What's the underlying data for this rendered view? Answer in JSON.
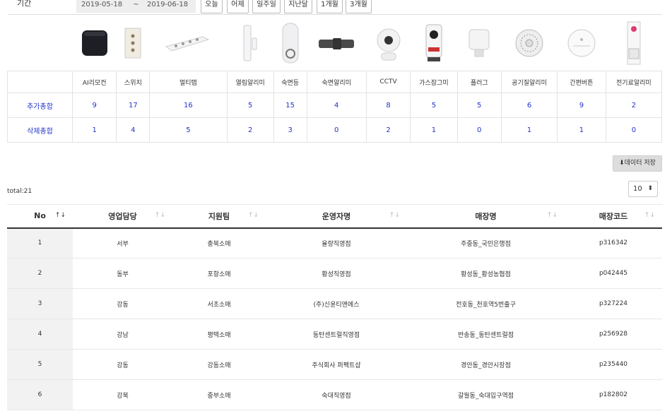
{
  "filter": {
    "label": "기간",
    "date_from": "2019-05-18",
    "tilde": "~",
    "date_to": "2019-06-18",
    "quick_ranges": [
      "오늘",
      "어제",
      "일주일",
      "지난달",
      "1개월",
      "3개월"
    ]
  },
  "devices": [
    {
      "name": "AI리모컨",
      "icon": "ai-remote-icon"
    },
    {
      "name": "스위치",
      "icon": "switch-icon"
    },
    {
      "name": "멀티탭",
      "icon": "power-strip-icon"
    },
    {
      "name": "열림알리미",
      "icon": "door-sensor-icon"
    },
    {
      "name": "숙면등",
      "icon": "sleep-lamp-icon"
    },
    {
      "name": "숙면알리미",
      "icon": "sleep-sensor-icon"
    },
    {
      "name": "CCTV",
      "icon": "cctv-icon"
    },
    {
      "name": "가스잠그미",
      "icon": "gas-lock-icon"
    },
    {
      "name": "플러그",
      "icon": "plug-icon"
    },
    {
      "name": "공기질알리미",
      "icon": "air-quality-icon"
    },
    {
      "name": "간편버튼",
      "icon": "simple-button-icon"
    },
    {
      "name": "전기료알리미",
      "icon": "power-meter-icon"
    }
  ],
  "summary_rows": [
    {
      "label": "추가총합",
      "values": [
        9,
        17,
        16,
        5,
        15,
        4,
        8,
        5,
        5,
        6,
        9,
        2
      ]
    },
    {
      "label": "삭제총합",
      "values": [
        1,
        4,
        5,
        2,
        3,
        0,
        2,
        1,
        0,
        1,
        1,
        0
      ]
    }
  ],
  "export_button": "데이터 저장",
  "total": "total:21",
  "page_size": "10",
  "table": {
    "columns": [
      "No",
      "영업담당",
      "지원팀",
      "운영자명",
      "매장명",
      "매장코드"
    ],
    "rows": [
      [
        "1",
        "서부",
        "충북소매",
        "율량직영점",
        "주중동_국민은행점",
        "p316342"
      ],
      [
        "2",
        "동부",
        "포항소매",
        "황성직영점",
        "황성동_황성농협점",
        "p042445"
      ],
      [
        "3",
        "강동",
        "서초소매",
        "(주)신윤티앤에스",
        "전호동_천호역5번출구",
        "p327224"
      ],
      [
        "4",
        "강남",
        "평택소매",
        "동탄센트럴직영점",
        "반송동_동탄센트럴점",
        "p256928"
      ],
      [
        "5",
        "강동",
        "강동소매",
        "주식회사 퍼펙트샵",
        "경안동_경안시장점",
        "p235440"
      ],
      [
        "6",
        "강북",
        "중부소매",
        "숙대직영점",
        "갈월동_숙대입구역점",
        "p182802"
      ]
    ]
  }
}
